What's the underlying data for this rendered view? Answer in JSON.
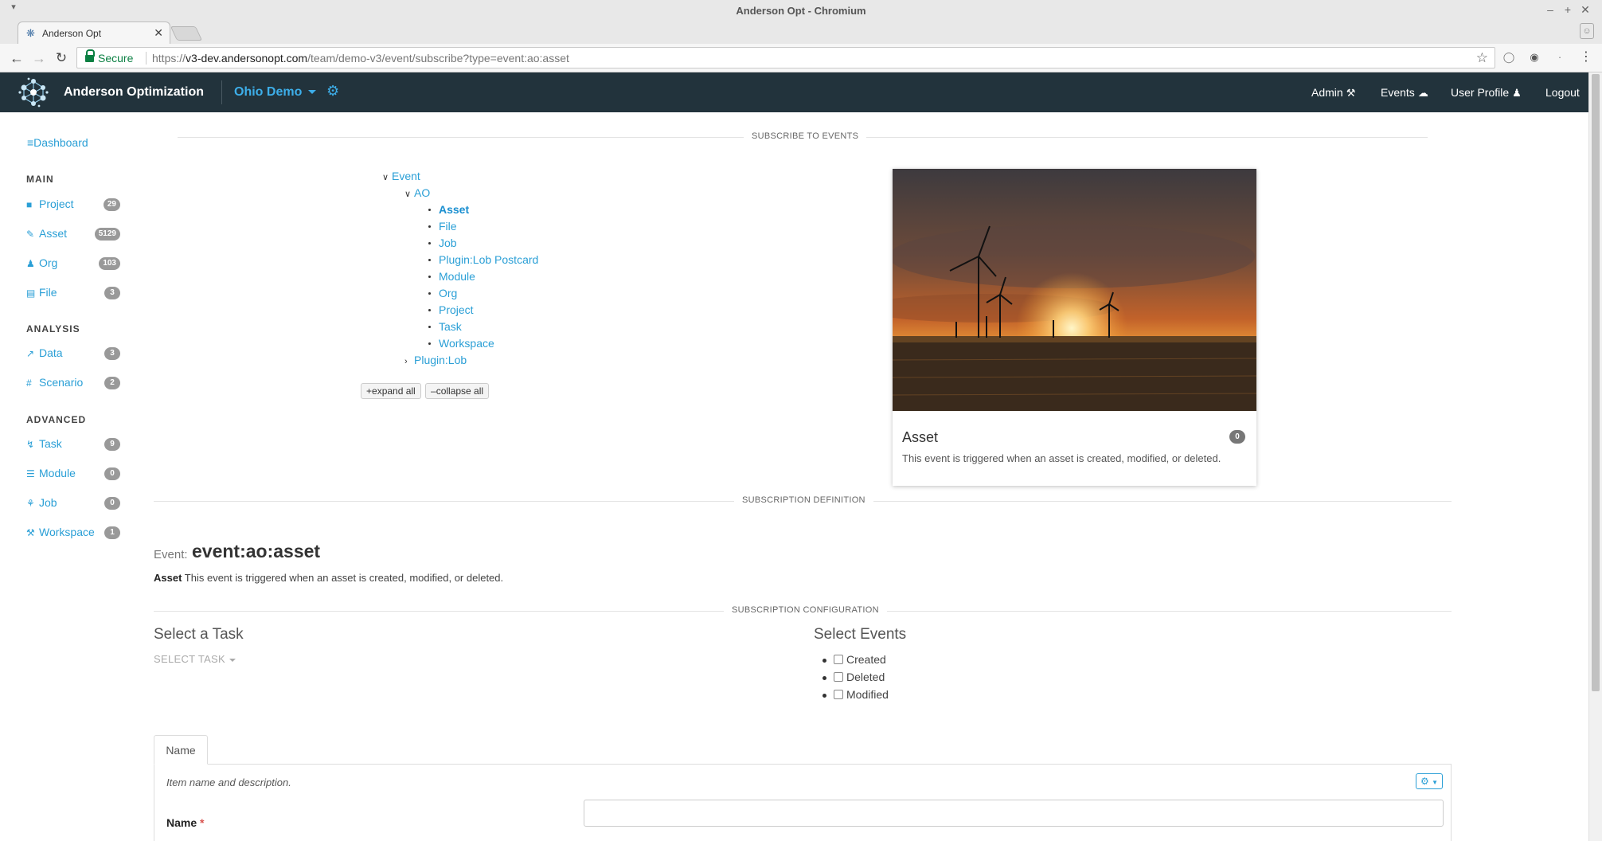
{
  "window": {
    "title": "Anderson Opt - Chromium"
  },
  "browser": {
    "tab_title": "Anderson Opt",
    "secure_label": "Secure",
    "url_scheme": "https://",
    "url_host": "v3-dev.andersonopt.com",
    "url_path": "/team/demo-v3/event/subscribe?type=event:ao:asset"
  },
  "nav": {
    "brand": "Anderson Optimization",
    "team": "Ohio Demo",
    "admin": "Admin",
    "events": "Events",
    "user_profile": "User Profile",
    "logout": "Logout"
  },
  "sidebar": {
    "dashboard": "Dashboard",
    "main_heading": "MAIN",
    "analysis_heading": "ANALYSIS",
    "advanced_heading": "ADVANCED",
    "items": [
      {
        "label": "Project",
        "count": "29"
      },
      {
        "label": "Asset",
        "count": "5129"
      },
      {
        "label": "Org",
        "count": "103"
      },
      {
        "label": "File",
        "count": "3"
      },
      {
        "label": "Data",
        "count": "3"
      },
      {
        "label": "Scenario",
        "count": "2"
      },
      {
        "label": "Task",
        "count": "9"
      },
      {
        "label": "Module",
        "count": "0"
      },
      {
        "label": "Job",
        "count": "0"
      },
      {
        "label": "Workspace",
        "count": "1"
      }
    ]
  },
  "sections": {
    "subscribe": "SUBSCRIBE TO EVENTS",
    "definition": "SUBSCRIPTION DEFINITION",
    "configuration": "SUBSCRIPTION CONFIGURATION"
  },
  "tree": {
    "root": "Event",
    "ao": "AO",
    "children": [
      "Asset",
      "File",
      "Job",
      "Plugin:Lob Postcard",
      "Module",
      "Org",
      "Project",
      "Task",
      "Workspace"
    ],
    "plugin": "Plugin:Lob",
    "expand_all": "expand all",
    "collapse_all": "collapse all"
  },
  "card": {
    "title": "Asset",
    "count": "0",
    "description": "This event is triggered when an asset is created, modified, or deleted."
  },
  "definition": {
    "event_label": "Event:",
    "event_name": "event:ao:asset",
    "desc_bold": "Asset",
    "desc_text": " This event is triggered when an asset is created, modified, or deleted."
  },
  "config": {
    "select_task_heading": "Select a Task",
    "select_task_button": "SELECT TASK",
    "select_events_heading": "Select Events",
    "events": [
      "Created",
      "Deleted",
      "Modified"
    ]
  },
  "form": {
    "tab": "Name",
    "description": "Item name and description.",
    "name_label": "Name",
    "required_mark": "*"
  },
  "icons": {
    "back": "arrow-left-icon",
    "forward": "arrow-right-icon",
    "reload": "reload-icon",
    "star": "star-icon",
    "gear": "gear-icon",
    "admin": "tools-icon",
    "events": "cloud-icon",
    "user": "user-icon"
  },
  "colors": {
    "navbar": "#22333c",
    "accent": "#2a9fd6",
    "badge": "#999999"
  }
}
